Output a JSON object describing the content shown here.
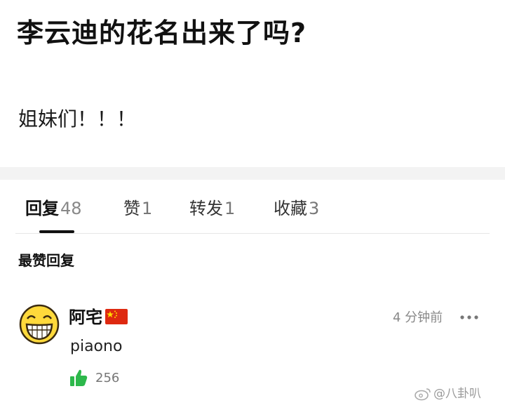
{
  "post": {
    "title": "李云迪的花名出来了吗?",
    "body": "姐妹们！！！"
  },
  "tabs": [
    {
      "label": "回复",
      "count": "48",
      "active": true
    },
    {
      "label": "赞",
      "count": "1",
      "active": false
    },
    {
      "label": "转发",
      "count": "1",
      "active": false
    },
    {
      "label": "收藏",
      "count": "3",
      "active": false
    }
  ],
  "section_title": "最赞回复",
  "comment": {
    "user": "阿宅",
    "flag": "china-flag-icon",
    "time": "4 分钟前",
    "text": "piaono",
    "likes": "256",
    "avatar": "grinning-face-emoji"
  },
  "watermark": "@八卦叭",
  "colors": {
    "like_green": "#2db84b",
    "flag_red": "#de2910",
    "flag_yellow": "#ffde00",
    "divider": "#f3f3f3"
  }
}
